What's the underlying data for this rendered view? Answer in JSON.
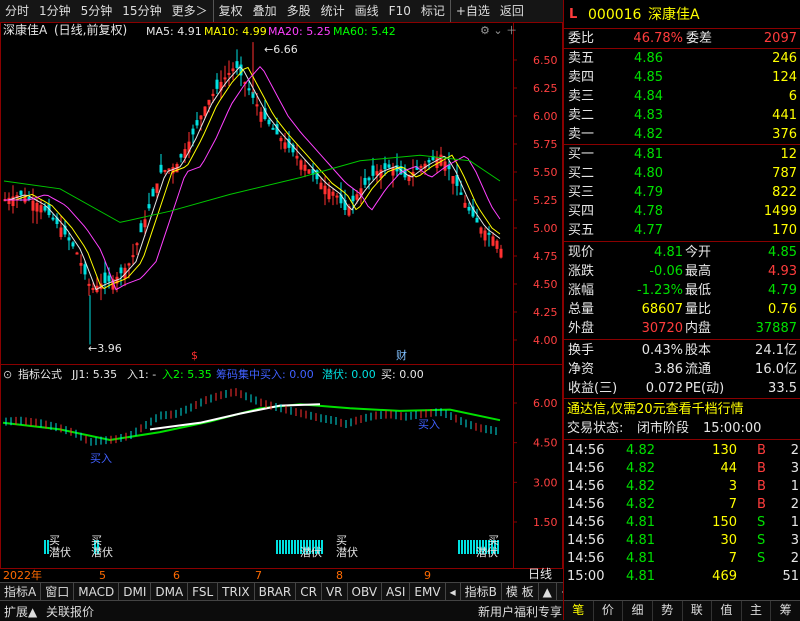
{
  "toolbar": {
    "items": [
      "分时",
      "1分钟",
      "5分钟",
      "15分钟",
      "更多＞",
      "复权",
      "叠加",
      "多股",
      "统计",
      "画线",
      "F10",
      "标记",
      "+自选",
      "返回"
    ]
  },
  "chart": {
    "header": {
      "stock": "深康佳A",
      "mode": "(日线,前复权)",
      "ma5": "MA5: 4.91",
      "ma10": "MA10: 4.99",
      "ma20": "MA20: 5.25",
      "ma60": "MA60: 5.42"
    },
    "high_label": "6.66",
    "low_label": "3.96",
    "price_ticks": [
      "6.50",
      "6.25",
      "6.00",
      "5.75",
      "5.50",
      "5.25",
      "5.00",
      "4.75",
      "4.50",
      "4.25",
      "4.00"
    ],
    "markers": {
      "s": "$",
      "cai": "财"
    },
    "indicator_header": {
      "name": "指标公式",
      "jj1": "JJ1: 5.35",
      "ru1": "入1: -",
      "ru2": "入2: 5.35",
      "chouma": "筹码集中买入: 0.00",
      "qianfu": "潜伏: 0.00",
      "mai": "买: 0.00"
    },
    "ind_ticks": [
      "6.00",
      "4.50",
      "3.00",
      "1.50"
    ],
    "ind_labels": {
      "buy_in": "买入",
      "buy": "买",
      "hide": "潜伏"
    },
    "x_labels": [
      "2022年",
      "5",
      "6",
      "7",
      "8",
      "9"
    ],
    "period": "日线"
  },
  "tabs": [
    "指标A",
    "窗口",
    "MACD",
    "DMI",
    "DMA",
    "FSL",
    "TRIX",
    "BRAR",
    "CR",
    "VR",
    "OBV",
    "ASI",
    "EMV",
    "◂",
    "指标B",
    "模 板",
    "▲",
    "+",
    "−"
  ],
  "status": {
    "left": [
      "扩展▲",
      "关联报价"
    ],
    "promo": "新用户福利专享",
    "right": [
      "笔",
      "价",
      "细",
      "势",
      "联",
      "值",
      "主",
      "筹"
    ]
  },
  "quote": {
    "tag": "L",
    "code": "000016",
    "name": "深康佳A",
    "weibi_label": "委比",
    "weibi": "46.78%",
    "weicha_label": "委差",
    "weicha": "2097",
    "asks": [
      {
        "label": "卖五",
        "price": "4.86",
        "vol": "246"
      },
      {
        "label": "卖四",
        "price": "4.85",
        "vol": "124"
      },
      {
        "label": "卖三",
        "price": "4.84",
        "vol": "6"
      },
      {
        "label": "卖二",
        "price": "4.83",
        "vol": "441"
      },
      {
        "label": "卖一",
        "price": "4.82",
        "vol": "376"
      }
    ],
    "bids": [
      {
        "label": "买一",
        "price": "4.81",
        "vol": "12"
      },
      {
        "label": "买二",
        "price": "4.80",
        "vol": "787"
      },
      {
        "label": "买三",
        "price": "4.79",
        "vol": "822"
      },
      {
        "label": "买四",
        "price": "4.78",
        "vol": "1499"
      },
      {
        "label": "买五",
        "price": "4.77",
        "vol": "170"
      }
    ],
    "stats": [
      {
        "l1": "现价",
        "v1": "4.81",
        "l2": "今开",
        "v2": "4.85"
      },
      {
        "l1": "涨跌",
        "v1": "-0.06",
        "l2": "最高",
        "v2": "4.93"
      },
      {
        "l1": "涨幅",
        "v1": "-1.23%",
        "l2": "最低",
        "v2": "4.79"
      },
      {
        "l1": "总量",
        "v1": "68607",
        "l2": "量比",
        "v2": "0.76"
      },
      {
        "l1": "外盘",
        "v1": "30720",
        "l2": "内盘",
        "v2": "37887"
      }
    ],
    "stats2": [
      {
        "l1": "换手",
        "v1": "0.43%",
        "l2": "股本",
        "v2": "24.1亿"
      },
      {
        "l1": "净资",
        "v1": "3.86",
        "l2": "流通",
        "v2": "16.0亿"
      },
      {
        "l1": "收益(三)",
        "v1": "0.072",
        "l2": "PE(动)",
        "v2": "33.5"
      }
    ],
    "ad": "通达信,仅需20元查看千档行情",
    "trade_state_label": "交易状态:",
    "trade_state": "闭市阶段",
    "trade_time": "15:00:00",
    "ticks": [
      {
        "t": "14:56",
        "p": "4.82",
        "v": "130",
        "d": "B",
        "n": "2"
      },
      {
        "t": "14:56",
        "p": "4.82",
        "v": "44",
        "d": "B",
        "n": "3"
      },
      {
        "t": "14:56",
        "p": "4.82",
        "v": "3",
        "d": "B",
        "n": "1"
      },
      {
        "t": "14:56",
        "p": "4.82",
        "v": "7",
        "d": "B",
        "n": "2"
      },
      {
        "t": "14:56",
        "p": "4.81",
        "v": "150",
        "d": "S",
        "n": "1"
      },
      {
        "t": "14:56",
        "p": "4.81",
        "v": "30",
        "d": "S",
        "n": "3"
      },
      {
        "t": "14:56",
        "p": "4.81",
        "v": "7",
        "d": "S",
        "n": "2"
      },
      {
        "t": "15:00",
        "p": "4.81",
        "v": "469",
        "d": "",
        "n": "51"
      }
    ]
  }
}
